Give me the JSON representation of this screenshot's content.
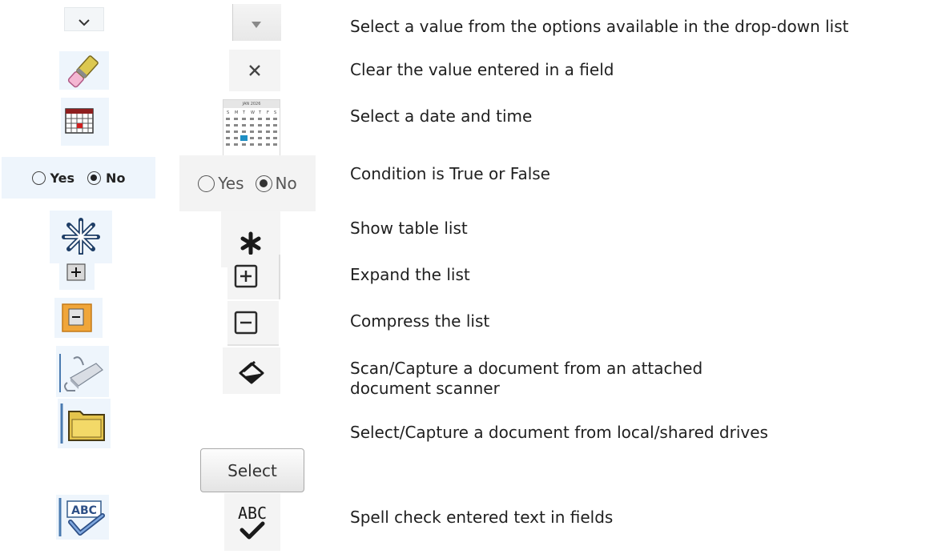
{
  "rows": [
    {
      "description": "Select a value from the options available in the drop-down list",
      "old_icon": "chevron-down-icon",
      "new_icon": "triangle-down-icon"
    },
    {
      "description": "Clear the value entered in a field",
      "old_icon": "eraser-icon",
      "new_icon": "close-icon"
    },
    {
      "description": "Select a date and time",
      "old_icon": "calendar-icon",
      "new_icon": "calendar-popup-icon"
    },
    {
      "description": "Condition is True or False",
      "old_icon": "radio-yes-no",
      "new_icon": "radio-yes-no"
    },
    {
      "description": "Show table list",
      "old_icon": "asterisk-outline-icon",
      "new_icon": "asterisk-icon"
    },
    {
      "description": "Expand the list",
      "old_icon": "plus-box-icon",
      "new_icon": "plus-square-icon"
    },
    {
      "description": "Compress the list",
      "old_icon": "minus-box-icon",
      "new_icon": "minus-square-icon"
    },
    {
      "description": "Scan/Capture a document from an attached document scanner",
      "old_icon": "scanner-icon",
      "new_icon": "scanner-icon"
    },
    {
      "description": "Select/Capture a document from local/shared drives",
      "old_icon": "folder-icon",
      "new_icon": "select-button"
    },
    {
      "description": "Spell check entered text in fields",
      "old_icon": "spell-check-icon",
      "new_icon": "spell-check-icon"
    }
  ],
  "radio": {
    "yes": "Yes",
    "no": "No"
  },
  "select_button_label": "Select",
  "spell_text": "ABC",
  "calendar_popup": {
    "header": "JAN 2026",
    "weekdays": [
      "S",
      "M",
      "T",
      "W",
      "T",
      "F",
      "S"
    ]
  }
}
